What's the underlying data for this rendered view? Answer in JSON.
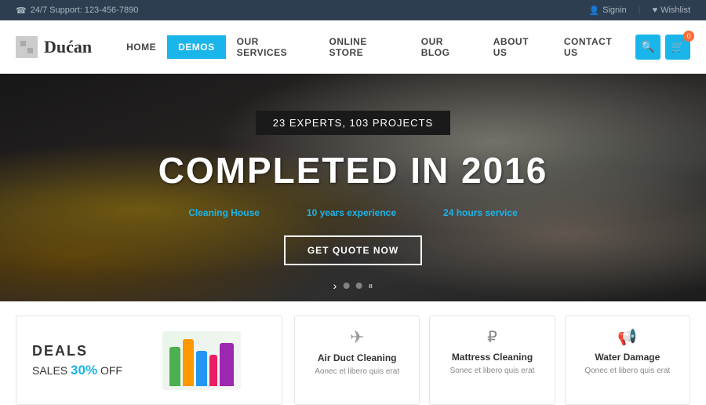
{
  "topbar": {
    "support_label": "24/7 Support: 123-456-7890",
    "phone_icon": "☎",
    "signin_label": "Signin",
    "signin_icon": "👤",
    "wishlist_label": "Wishlist",
    "wishlist_icon": "♥"
  },
  "header": {
    "logo_text": "Dućan",
    "logo_icon": "✦",
    "nav_items": [
      {
        "label": "HOME",
        "active": false
      },
      {
        "label": "DEMOS",
        "active": true
      },
      {
        "label": "OUR SERVICES",
        "active": false
      },
      {
        "label": "ONLINE STORE",
        "active": false
      },
      {
        "label": "OUR BLOG",
        "active": false
      },
      {
        "label": "ABOUT US",
        "active": false
      },
      {
        "label": "CONTACT US",
        "active": false
      }
    ],
    "search_icon": "🔍",
    "cart_icon": "🛒",
    "cart_count": "0"
  },
  "hero": {
    "tag": "23 EXPERTS, 103 PROJECTS",
    "title": "COMPLETED IN 2016",
    "features": [
      {
        "label": "Cleaning House"
      },
      {
        "label": "10 years experience"
      },
      {
        "label": "24 hours service"
      }
    ],
    "cta_label": "GET QUOTE NOW"
  },
  "bottom": {
    "deals": {
      "title": "DEALS",
      "subtitle_prefix": "SALES ",
      "discount": "30%",
      "subtitle_suffix": " OFF"
    },
    "services": [
      {
        "icon": "✈",
        "name": "Air Duct Cleaning",
        "desc": "Aonec et libero quis erat"
      },
      {
        "icon": "₽",
        "name": "Mattress Cleaning",
        "desc": "Sonec et libero quis erat"
      },
      {
        "icon": "📢",
        "name": "Water Damage",
        "desc": "Qonec et libero quis erat"
      }
    ]
  },
  "slider_dots": [
    "arrow",
    "dot-inactive",
    "dot-inactive",
    "pause"
  ]
}
